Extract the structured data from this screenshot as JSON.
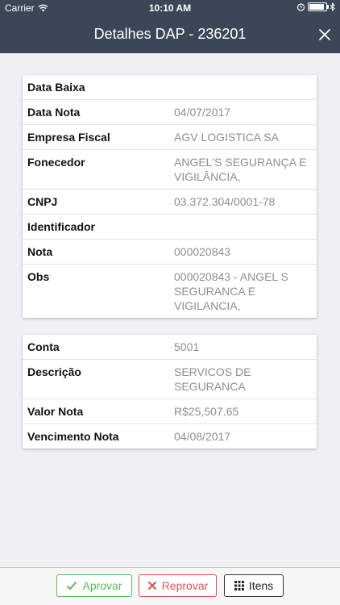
{
  "status_bar": {
    "carrier": "Carrier",
    "time": "10:10 AM",
    "icons": [
      "wifi-icon",
      "alarm-icon",
      "battery-icon",
      "bluetooth-icon"
    ]
  },
  "header": {
    "title": "Detalhes DAP - 236201",
    "close_icon": "close-icon",
    "background_color": "#3b4756"
  },
  "card1": {
    "rows": [
      {
        "label": "Data Baixa",
        "value": ""
      },
      {
        "label": "Data Nota",
        "value": "04/07/2017"
      },
      {
        "label": "Empresa Fiscal",
        "value": "AGV LOGISTICA SA"
      },
      {
        "label": "Fonecedor",
        "value": "ANGEL'S SEGURANÇA E VIGILÂNCIA,"
      },
      {
        "label": "CNPJ",
        "value": "03.372.304/0001-78"
      },
      {
        "label": "Identificador",
        "value": ""
      },
      {
        "label": "Nota",
        "value": "000020843"
      },
      {
        "label": "Obs",
        "value": "000020843 - ANGEL S SEGURANCA E VIGILANCIA,"
      }
    ]
  },
  "card2": {
    "rows": [
      {
        "label": "Conta",
        "value": "5001"
      },
      {
        "label": "Descrição",
        "value": "SERVICOS DE SEGURANCA"
      },
      {
        "label": "Valor Nota",
        "value": "R$25,507.65"
      },
      {
        "label": "Vencimento Nota",
        "value": "04/08/2017"
      }
    ]
  },
  "toolbar": {
    "approve_label": "Aprovar",
    "reject_label": "Reprovar",
    "items_label": "Itens",
    "approve_color": "#5cb85c",
    "reject_color": "#d9534f"
  }
}
